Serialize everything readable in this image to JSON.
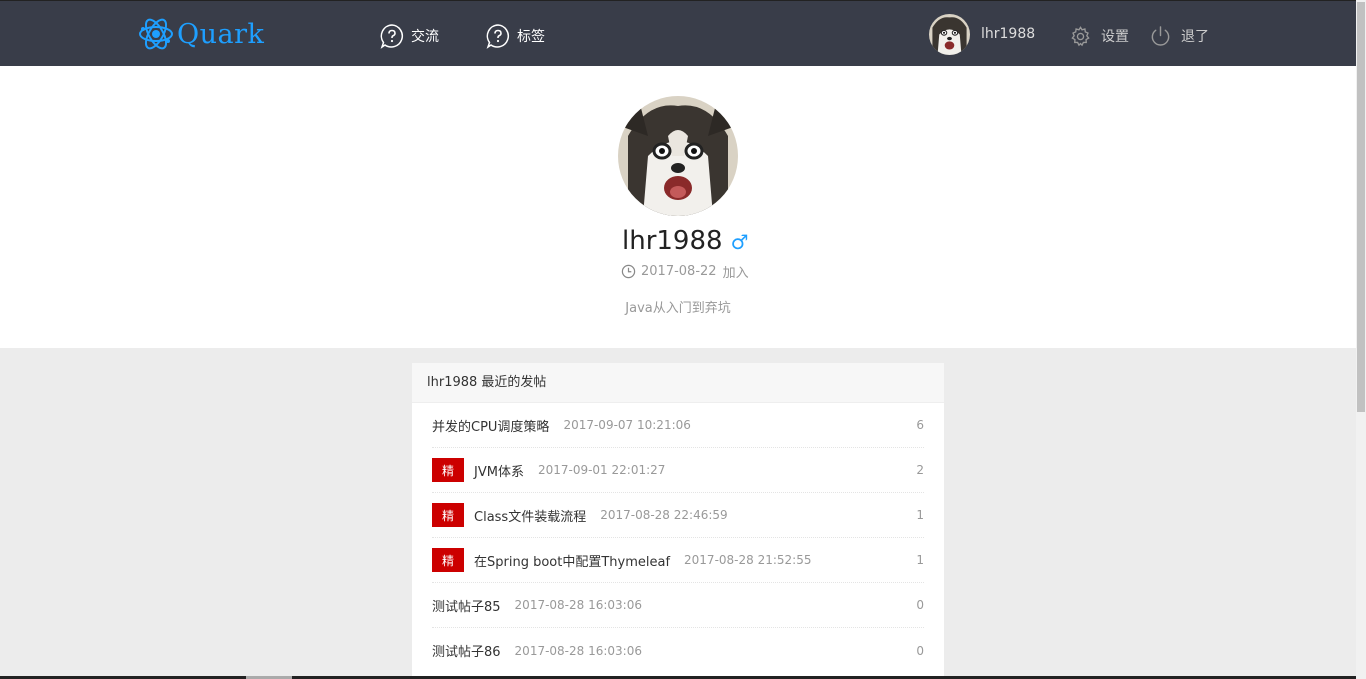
{
  "header": {
    "logo_text": "Quark",
    "nav": [
      {
        "label": "交流",
        "icon": "question-circle-icon"
      },
      {
        "label": "标签",
        "icon": "question-circle-icon"
      }
    ],
    "user_name": "lhr1988",
    "settings_label": "设置",
    "logout_label": "退了"
  },
  "profile": {
    "name": "lhr1988",
    "gender_symbol": "♂",
    "join_date": "2017-08-22",
    "join_suffix": "加入",
    "bio": "Java从入门到弃坑"
  },
  "recent_posts": {
    "title": "lhr1988 最近的发帖",
    "badge_label": "精",
    "items": [
      {
        "title": "并发的CPU调度策略",
        "time": "2017-09-07 10:21:06",
        "count": "6",
        "featured": false
      },
      {
        "title": "JVM体系",
        "time": "2017-09-01 22:01:27",
        "count": "2",
        "featured": true
      },
      {
        "title": "Class文件装载流程",
        "time": "2017-08-28 22:46:59",
        "count": "1",
        "featured": true
      },
      {
        "title": "在Spring boot中配置Thymeleaf",
        "time": "2017-08-28 21:52:55",
        "count": "1",
        "featured": true
      },
      {
        "title": "测试帖子85",
        "time": "2017-08-28 16:03:06",
        "count": "0",
        "featured": false
      },
      {
        "title": "测试帖子86",
        "time": "2017-08-28 16:03:06",
        "count": "0",
        "featured": false
      }
    ]
  },
  "colors": {
    "topbar": "#393d49",
    "accent": "#1e9fff",
    "badge": "#cc0000"
  }
}
